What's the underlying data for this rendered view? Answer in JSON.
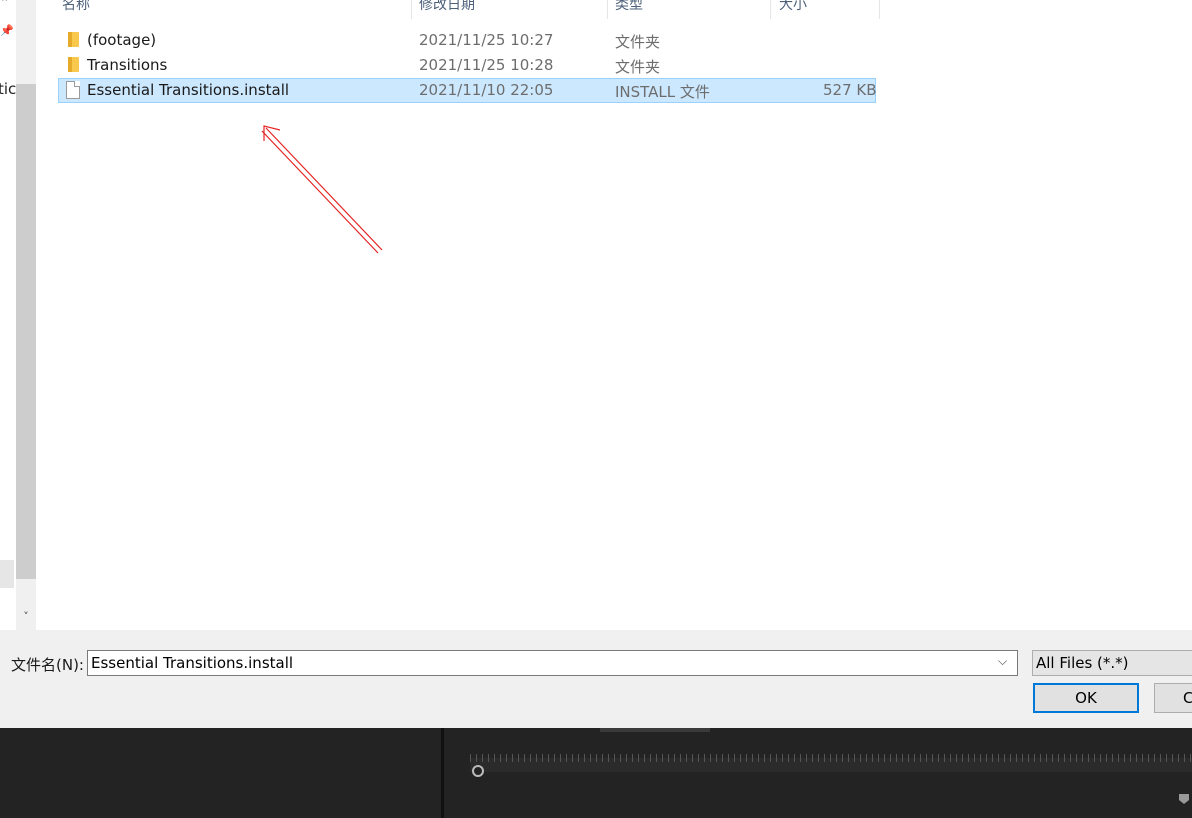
{
  "nav": {
    "partial_label": "tic"
  },
  "columns": {
    "name": "名称",
    "date": "修改日期",
    "type": "类型",
    "size": "大小"
  },
  "files": [
    {
      "name": "(footage)",
      "date": "2021/11/25 10:27",
      "type": "文件夹",
      "size": "",
      "icon": "folder-icon"
    },
    {
      "name": "Transitions",
      "date": "2021/11/25 10:28",
      "type": "文件夹",
      "size": "",
      "icon": "folder-icon"
    },
    {
      "name": "Essential Transitions.install",
      "date": "2021/11/10 22:05",
      "type": "INSTALL 文件",
      "size": "527 KB",
      "icon": "file-icon",
      "selected": true
    }
  ],
  "footer": {
    "filename_label": "文件名(N):",
    "filename_value": "Essential Transitions.install",
    "filter_value": "All Files (*.*)",
    "ok_label": "OK",
    "cancel_label_partial": "C"
  },
  "colors": {
    "selection": "#cce8ff",
    "annotation_arrow": "#e52222",
    "ok_border": "#0078d7"
  }
}
